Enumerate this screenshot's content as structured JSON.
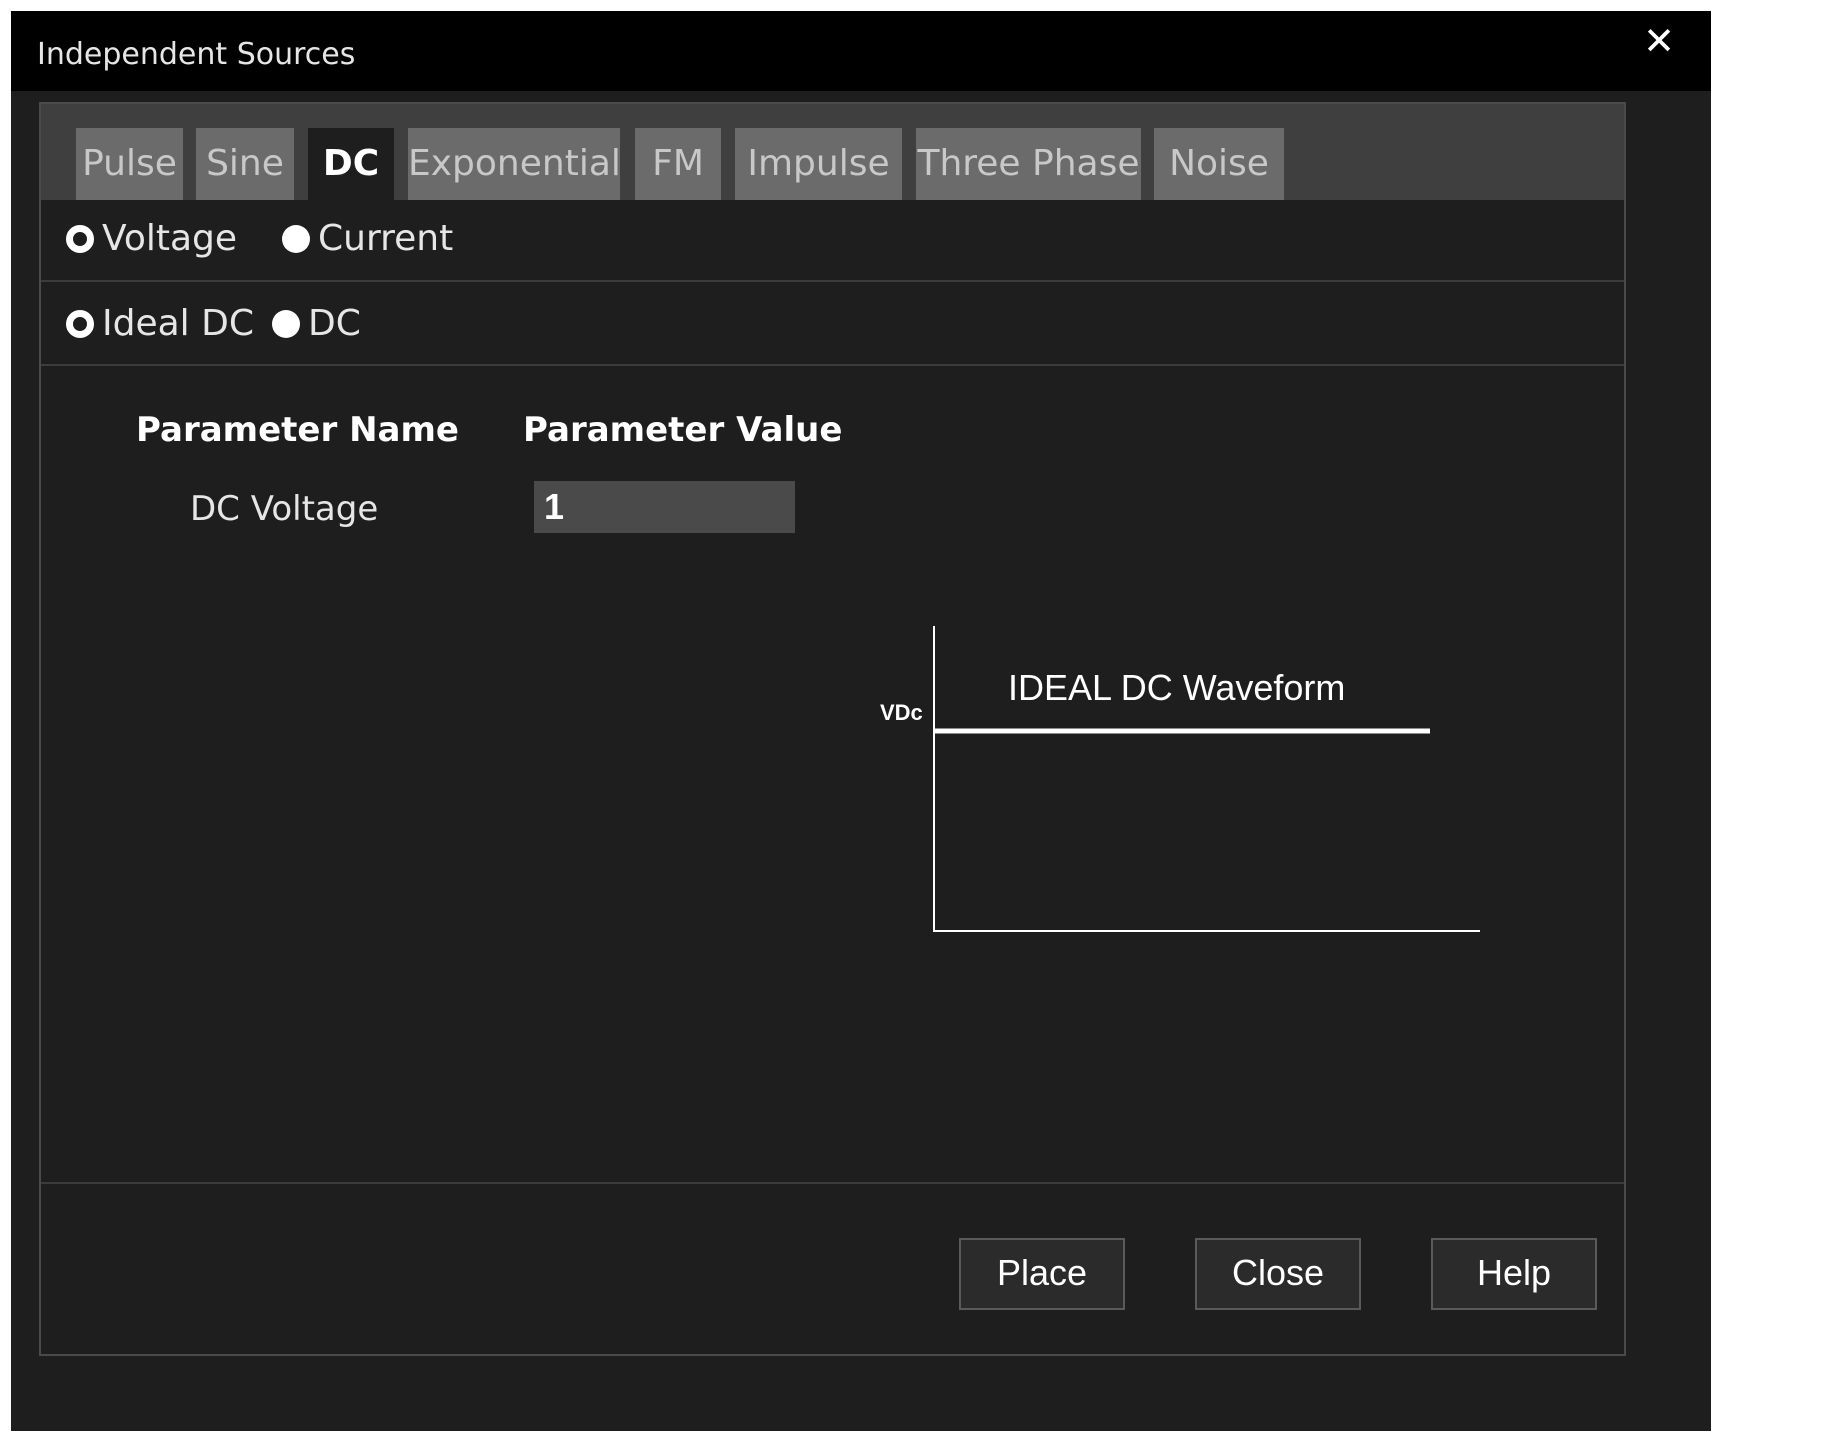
{
  "window": {
    "title": "Independent Sources",
    "close_glyph": "✕"
  },
  "tabs": [
    {
      "label": "Pulse",
      "active": false
    },
    {
      "label": "Sine",
      "active": false
    },
    {
      "label": "DC",
      "active": true
    },
    {
      "label": "Exponential",
      "active": false
    },
    {
      "label": "FM",
      "active": false
    },
    {
      "label": "Impulse",
      "active": false
    },
    {
      "label": "Three Phase",
      "active": false
    },
    {
      "label": "Noise",
      "active": false
    }
  ],
  "source_type": {
    "options": [
      {
        "label": "Voltage",
        "selected": true
      },
      {
        "label": "Current",
        "selected": false
      }
    ]
  },
  "dc_type": {
    "options": [
      {
        "label": "Ideal DC",
        "selected": true
      },
      {
        "label": "DC",
        "selected": false
      }
    ]
  },
  "parameters": {
    "header_name": "Parameter Name",
    "header_value": "Parameter Value",
    "rows": [
      {
        "name": "DC Voltage",
        "value": "1"
      }
    ]
  },
  "waveform": {
    "title": "IDEAL DC Waveform",
    "y_label": "VDc"
  },
  "buttons": {
    "place": "Place",
    "close": "Close",
    "help": "Help"
  },
  "colors": {
    "dialog_bg": "#1e1e1e",
    "titlebar_bg": "#000000",
    "tab_inactive": "#6b6b6b",
    "tab_strip": "#3f3f3f",
    "input_bg": "#4a4a4a"
  }
}
